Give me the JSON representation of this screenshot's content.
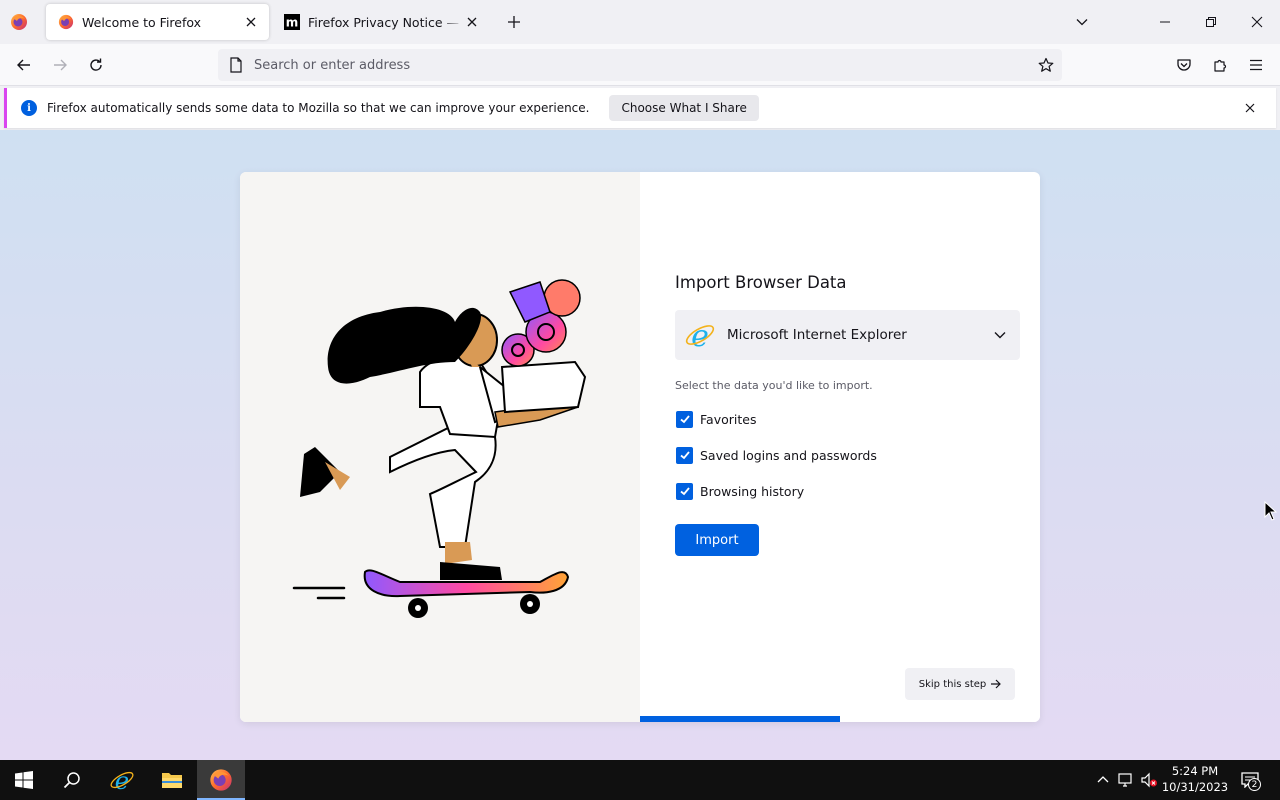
{
  "window": {
    "tabs": [
      {
        "title": "Welcome to Firefox",
        "active": true,
        "favicon": "firefox-icon"
      },
      {
        "title": "Firefox Privacy Notice — Mozilla",
        "active": false,
        "favicon": "mozilla-m-icon"
      }
    ]
  },
  "navbar": {
    "url_placeholder": "Search or enter address"
  },
  "notification": {
    "message": "Firefox automatically sends some data to Mozilla so that we can improve your experience.",
    "button_label": "Choose What I Share"
  },
  "import_card": {
    "title": "Import Browser Data",
    "selected_browser": "Microsoft Internet Explorer",
    "select_hint": "Select the data you'd like to import.",
    "options": [
      {
        "label": "Favorites",
        "checked": true
      },
      {
        "label": "Saved logins and passwords",
        "checked": true
      },
      {
        "label": "Browsing history",
        "checked": true
      }
    ],
    "import_label": "Import",
    "skip_label": "Skip this step",
    "progress_fraction": 0.5
  },
  "taskbar": {
    "time": "5:24 PM",
    "date": "10/31/2023",
    "notification_count": "2"
  },
  "colors": {
    "accent": "#0061e0",
    "notification_border": "#d946ef",
    "taskbar": "#101010"
  }
}
